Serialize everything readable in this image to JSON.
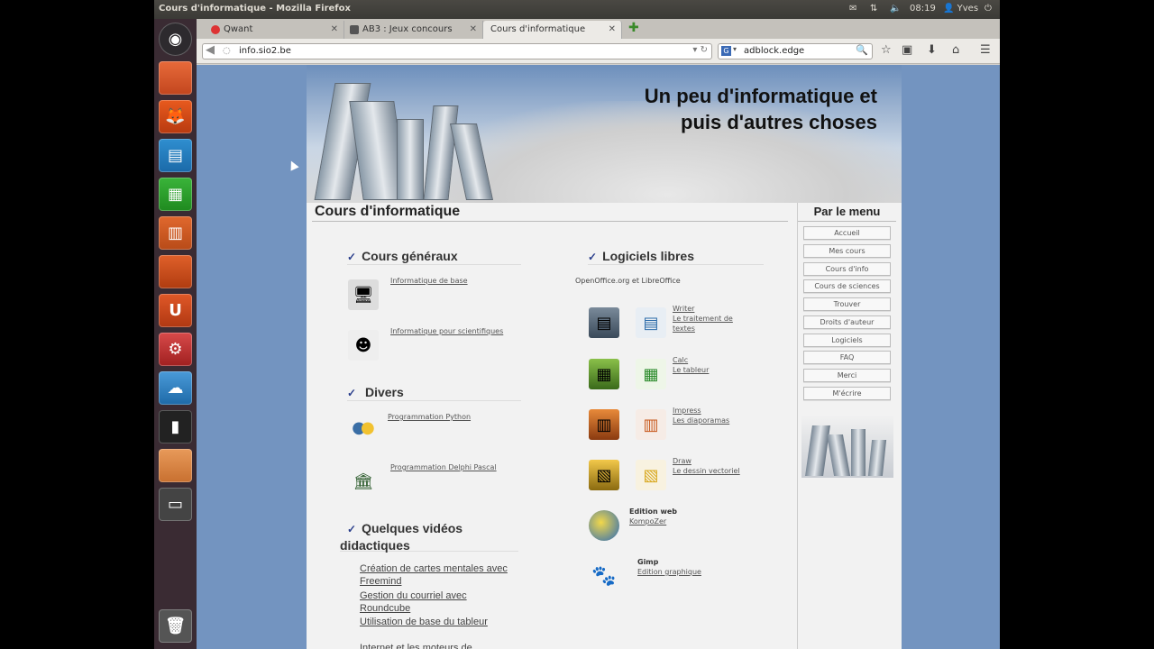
{
  "topbar": {
    "window_title": "Cours d'informatique - Mozilla Firefox",
    "time": "08:19",
    "user": "Yves"
  },
  "tabs": [
    {
      "label": "Qwant",
      "color": "#d33"
    },
    {
      "label": "AB3 : Jeux concours",
      "color": "#555"
    },
    {
      "label": "Cours d'informatique",
      "color": ""
    }
  ],
  "navbar": {
    "url": "info.sio2.be",
    "search_text": "adblock.edge"
  },
  "banner": {
    "title_line1": "Un peu d'informatique et",
    "title_line2": "puis d'autres choses"
  },
  "content": {
    "title": "Cours d'informatique",
    "general": {
      "heading": "Cours généraux",
      "links": [
        "Informatique de base",
        "Informatique pour scientifiques"
      ]
    },
    "divers": {
      "heading": "Divers",
      "links": [
        "Programmation Python",
        "Programmation Delphi Pascal"
      ]
    },
    "videos": {
      "heading_line1": "Quelques vidéos",
      "heading_line2": "didactiques",
      "links": [
        "Création de cartes mentales avec",
        "Freemind",
        "Gestion du courriel avec",
        "Roundcube",
        "Utilisation de base du tableur",
        "Internet et les moteurs de"
      ]
    },
    "libres": {
      "heading": "Logiciels libres",
      "subtitle": "OpenOffice.org et LibreOffice",
      "apps": [
        {
          "name": "Writer",
          "desc1": "Le traitement de",
          "desc2": "textes"
        },
        {
          "name": "Calc",
          "desc1": "Le tableur",
          "desc2": ""
        },
        {
          "name": "Impress",
          "desc1": "Les diaporamas",
          "desc2": ""
        },
        {
          "name": "Draw",
          "desc1": "Le dessin vectoriel",
          "desc2": ""
        }
      ],
      "web": {
        "name": "Edition web",
        "desc": "KompoZer"
      },
      "gimp": {
        "name": "Gimp",
        "desc": "Edition graphique"
      }
    }
  },
  "sidebar": {
    "heading": "Par le menu",
    "items": [
      "Accueil",
      "Mes cours",
      "Cours d'info",
      "Cours de sciences",
      "Trouver",
      "Droits d'auteur",
      "Logiciels",
      "FAQ",
      "Merci",
      "M'écrire"
    ]
  }
}
